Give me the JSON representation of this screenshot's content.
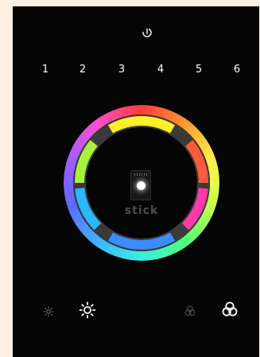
{
  "power": {
    "icon": "power-icon"
  },
  "zones": [
    "1",
    "2",
    "3",
    "4",
    "5",
    "6"
  ],
  "color_wheel": {
    "icon": "color-wheel",
    "ring_gradient": [
      "#ff3b3b",
      "#ff9a2e",
      "#fff04a",
      "#c8ff4d",
      "#4dff7a",
      "#37f0e0",
      "#3fb4ff",
      "#5a6cff",
      "#a25cff",
      "#ff4fc8",
      "#ff3b3b"
    ],
    "segment_colors": {
      "top": "#fff02a",
      "upper_right": "#ff5a3a",
      "lower_right": "#ff3aa8",
      "bottom": "#3a8cff",
      "lower_left": "#2ab8ff",
      "upper_left": "#a8f040"
    }
  },
  "brand": {
    "text": "stick"
  },
  "brightness": {
    "down_icon": "brightness-down-icon",
    "up_icon": "brightness-up-icon"
  },
  "color_cycle": {
    "off_icon": "color-cycle-dim-icon",
    "on_icon": "color-cycle-icon"
  }
}
